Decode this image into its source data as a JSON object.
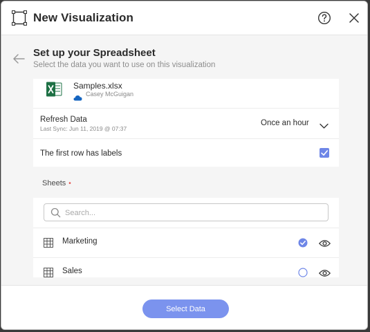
{
  "dialog": {
    "title": "New Visualization",
    "icons": {
      "visualization": "visualization-frame-icon",
      "help": "help-circle-icon",
      "close": "close-icon"
    }
  },
  "step": {
    "title": "Set up your Spreadsheet",
    "subtitle": "Select the data you want to use on this visualization"
  },
  "file": {
    "name": "Samples.xlsx",
    "owner": "Casey McGuigan",
    "icon": "excel-icon",
    "source_icon": "onedrive-cloud-icon"
  },
  "refresh": {
    "label": "Refresh Data",
    "last_sync": "Last Sync: Jun 11, 2019 @ 07:37",
    "selected": "Once an hour"
  },
  "first_row_labels": {
    "label": "The first row has labels",
    "checked": true
  },
  "sheets": {
    "label": "Sheets",
    "required_marker": "•",
    "search_placeholder": "Search...",
    "items": [
      {
        "name": "Marketing",
        "selected": true
      },
      {
        "name": "Sales",
        "selected": false
      }
    ]
  },
  "footer": {
    "select_label": "Select Data"
  },
  "colors": {
    "accent": "#6e86e7",
    "button": "#7b93ee",
    "excel_green": "#1d7044",
    "onedrive_blue": "#1565c0",
    "required_red": "#e5544f"
  }
}
